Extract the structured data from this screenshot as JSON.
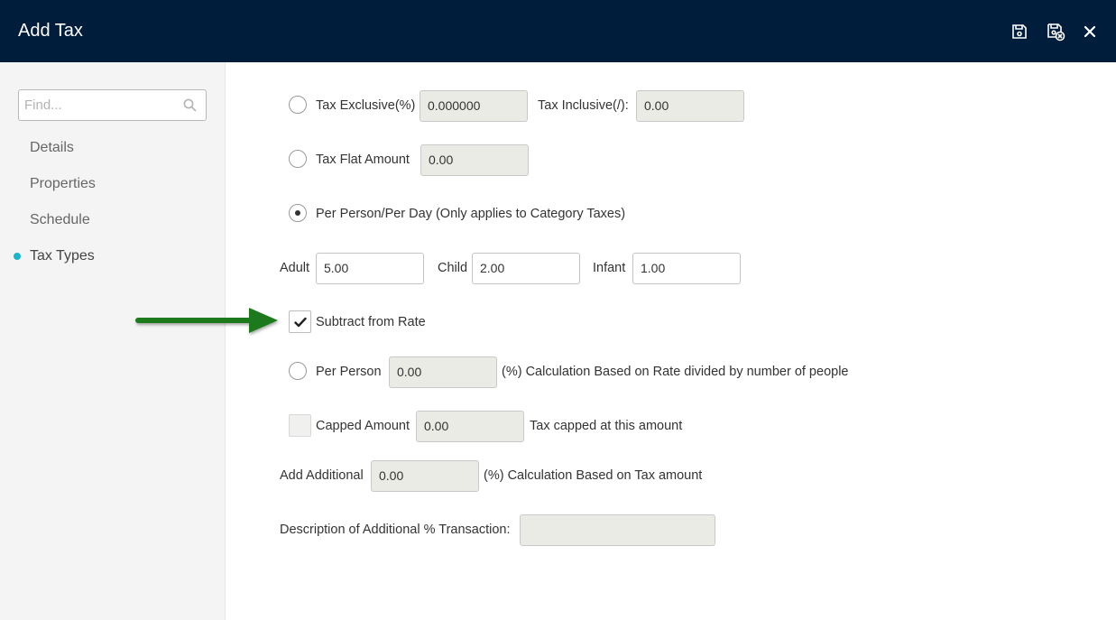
{
  "header": {
    "title": "Add Tax",
    "icons": [
      "save-icon",
      "save-close-icon",
      "close-icon"
    ]
  },
  "sidebar": {
    "search_placeholder": "Find...",
    "items": [
      {
        "label": "Details",
        "active": false
      },
      {
        "label": "Properties",
        "active": false
      },
      {
        "label": "Schedule",
        "active": false
      },
      {
        "label": "Tax Types",
        "active": true
      }
    ]
  },
  "form": {
    "tax_exclusive_label": "Tax Exclusive(%)",
    "tax_exclusive_value": "0.000000",
    "tax_inclusive_label": "Tax Inclusive(/):",
    "tax_inclusive_value": "0.00",
    "tax_flat_label": "Tax Flat Amount",
    "tax_flat_value": "0.00",
    "per_person_day_label": "Per Person/Per Day (Only applies to Category Taxes)",
    "adult_label": "Adult",
    "adult_value": "5.00",
    "child_label": "Child",
    "child_value": "2.00",
    "infant_label": "Infant",
    "infant_value": "1.00",
    "subtract_label": "Subtract from Rate",
    "subtract_checked": true,
    "per_person_label": "Per Person",
    "per_person_value": "0.00",
    "per_person_desc": "(%) Calculation Based on Rate divided by number of people",
    "capped_label": "Capped Amount",
    "capped_value": "0.00",
    "capped_desc": "Tax capped at this amount",
    "add_additional_label": "Add Additional",
    "add_additional_value": "0.00",
    "add_additional_desc": "(%) Calculation Based on Tax amount",
    "description_label": "Description of Additional % Transaction:",
    "description_value": ""
  },
  "colors": {
    "header_bg": "#011d3c",
    "active_dot": "#19b5c8",
    "arrow": "#1f7a1f"
  }
}
